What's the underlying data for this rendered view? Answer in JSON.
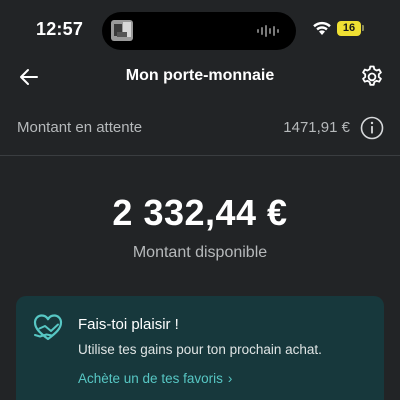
{
  "status_bar": {
    "time": "12:57",
    "battery_level": "16",
    "icons": [
      "wifi-icon",
      "battery-icon"
    ]
  },
  "header": {
    "title": "Mon porte-monnaie",
    "back_icon": "arrow-left-icon",
    "settings_icon": "gear-icon"
  },
  "pending": {
    "label": "Montant en attente",
    "amount": "1471,91 €",
    "info_icon": "info-icon"
  },
  "balance": {
    "amount": "2 332,44 €",
    "label": "Montant disponible"
  },
  "promo": {
    "icon": "heart-icon",
    "title": "Fais-toi plaisir !",
    "text": "Utilise tes gains pour ton prochain achat.",
    "link_label": "Achète un de tes favoris",
    "link_chevron": "›",
    "link_color": "#57c7c4",
    "background_color": "#17383c"
  },
  "colors": {
    "background": "#222426",
    "battery": "#f0e033",
    "secondary_text": "#b6b9bb"
  }
}
